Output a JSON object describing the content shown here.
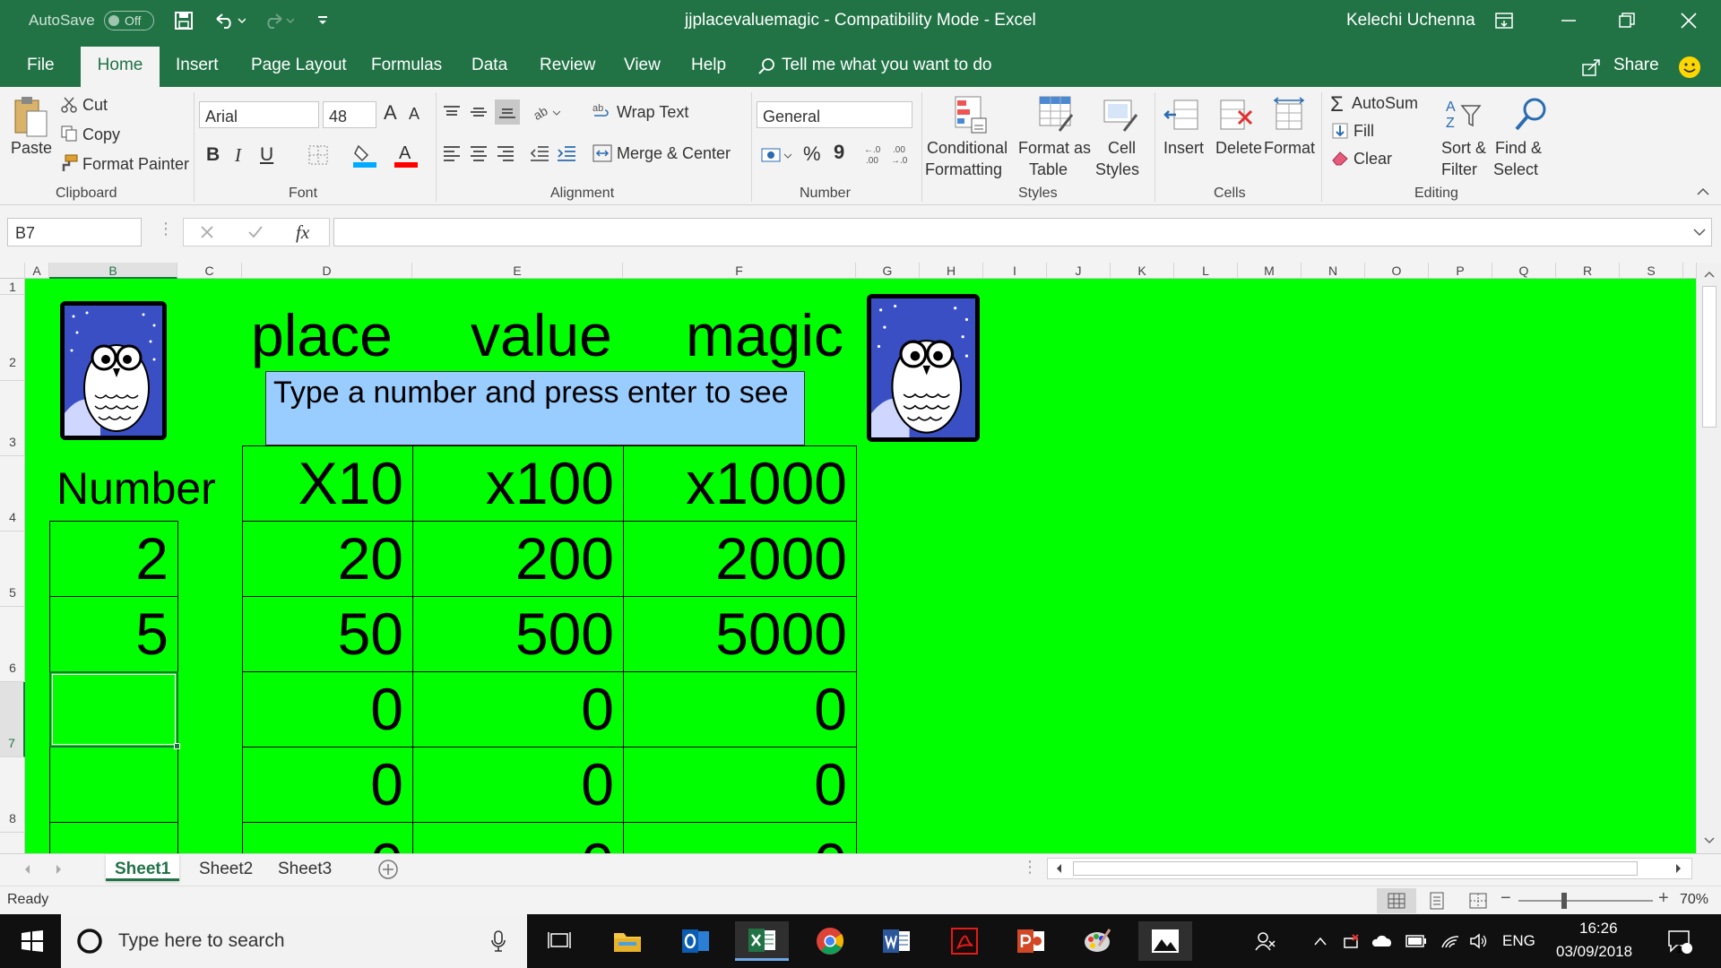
{
  "titlebar": {
    "autosave_label": "AutoSave",
    "autosave_state": "Off",
    "title": "jjplacevaluemagic  -  Compatibility Mode  -  Excel",
    "user": "Kelechi Uchenna"
  },
  "tabs": [
    "File",
    "Home",
    "Insert",
    "Page Layout",
    "Formulas",
    "Data",
    "Review",
    "View",
    "Help"
  ],
  "active_tab": "Home",
  "tell_me": "Tell me what you want to do",
  "share_label": "Share",
  "ribbon": {
    "clipboard": {
      "paste": "Paste",
      "cut": "Cut",
      "copy": "Copy",
      "format_painter": "Format Painter",
      "label": "Clipboard"
    },
    "font": {
      "name": "Arial",
      "size": "48",
      "label": "Font",
      "bold": "B",
      "italic": "I",
      "underline": "U",
      "grow": "A",
      "shrink": "A",
      "color_a": "A"
    },
    "alignment": {
      "wrap": "Wrap Text",
      "merge": "Merge & Center",
      "label": "Alignment"
    },
    "number": {
      "format": "General",
      "percent": "%",
      "comma": "9",
      "label": "Number"
    },
    "styles": {
      "conditional": "Conditional",
      "conditional2": "Formatting",
      "format_as": "Format as",
      "format_as2": "Table",
      "cell": "Cell",
      "cell2": "Styles",
      "label": "Styles"
    },
    "cells": {
      "insert": "Insert",
      "delete": "Delete",
      "format": "Format",
      "label": "Cells"
    },
    "editing": {
      "autosum": "AutoSum",
      "fill": "Fill",
      "clear": "Clear",
      "sort": "Sort &",
      "sort2": "Filter",
      "find": "Find &",
      "find2": "Select",
      "label": "Editing"
    }
  },
  "formula_bar": {
    "name_box": "B7",
    "fx": "fx",
    "value": ""
  },
  "columns": [
    "A",
    "B",
    "C",
    "D",
    "E",
    "F",
    "G",
    "H",
    "I",
    "J",
    "K",
    "L",
    "M",
    "N",
    "O",
    "P",
    "Q",
    "R",
    "S"
  ],
  "rows": [
    "1",
    "2",
    "3",
    "4",
    "5",
    "6",
    "7",
    "8"
  ],
  "sheet": {
    "heading_words": [
      "place",
      "value",
      "magic"
    ],
    "instruction": "Type a number and press enter to see",
    "number_label": "Number",
    "col_headers": [
      "X10",
      "x100",
      "x1000"
    ],
    "table": [
      {
        "number": "2",
        "x10": "20",
        "x100": "200",
        "x1000": "2000"
      },
      {
        "number": "5",
        "x10": "50",
        "x100": "500",
        "x1000": "5000"
      },
      {
        "number": "",
        "x10": "0",
        "x100": "0",
        "x1000": "0"
      },
      {
        "number": "",
        "x10": "0",
        "x100": "0",
        "x1000": "0"
      }
    ],
    "bg_color": "#00ff00",
    "note_color": "#99ccff"
  },
  "sheet_tabs": [
    "Sheet1",
    "Sheet2",
    "Sheet3"
  ],
  "active_sheet": "Sheet1",
  "status": {
    "ready": "Ready",
    "zoom": "70%"
  },
  "taskbar": {
    "search": "Type here to search",
    "lang": "ENG",
    "time": "16:26",
    "date": "03/09/2018",
    "notif_count": "1"
  },
  "colors": {
    "excel_green": "#217346",
    "sheet_green": "#00ff00",
    "taskbar": "#101010"
  }
}
